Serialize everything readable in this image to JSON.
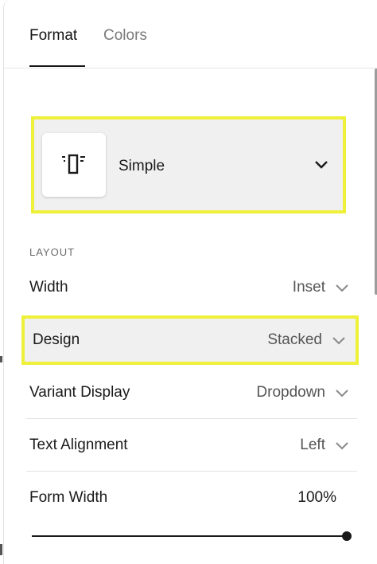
{
  "tabs": [
    {
      "label": "Format",
      "active": true
    },
    {
      "label": "Colors",
      "active": false
    }
  ],
  "format_select": {
    "label": "Simple",
    "icon": "stacked-layout-icon"
  },
  "layout": {
    "section_title": "LAYOUT",
    "rows": [
      {
        "label": "Width",
        "value": "Inset"
      },
      {
        "label": "Design",
        "value": "Stacked"
      },
      {
        "label": "Variant Display",
        "value": "Dropdown"
      },
      {
        "label": "Text Alignment",
        "value": "Left"
      }
    ]
  },
  "form_width": {
    "label": "Form Width",
    "value": "100%",
    "slider_fraction": 1.0
  },
  "colors": {
    "highlight": "#eef03a",
    "panel_bg": "#f0f0f0",
    "text": "#1a1a1a",
    "muted": "#7a7a7a"
  }
}
